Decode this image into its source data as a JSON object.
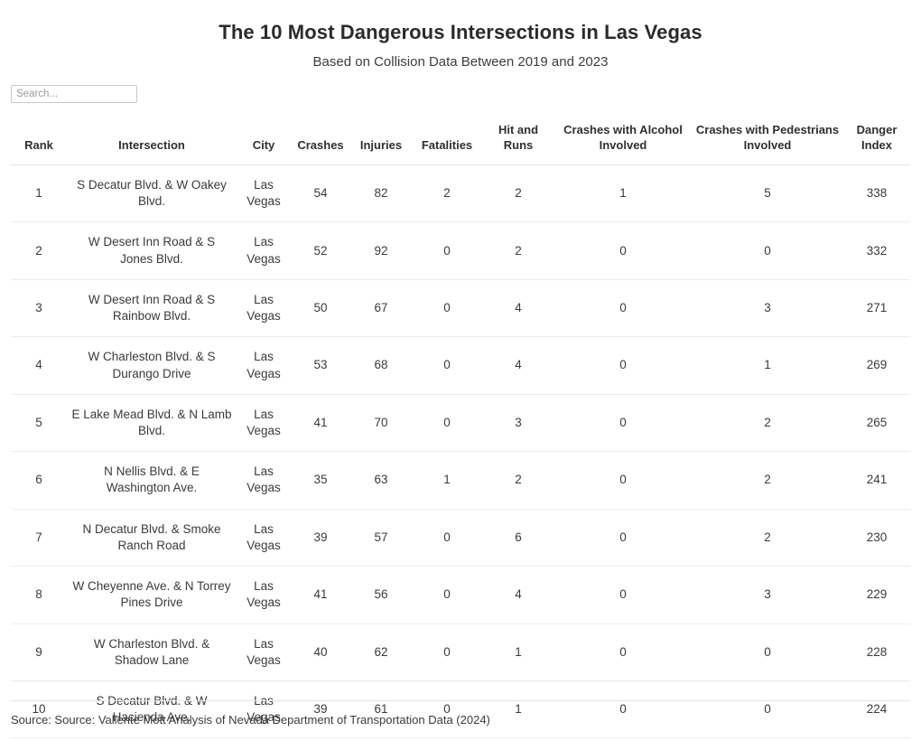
{
  "header": {
    "title": "The 10 Most Dangerous Intersections in Las Vegas",
    "subtitle": "Based on Collision Data Between 2019 and 2023"
  },
  "search": {
    "placeholder": "Search...",
    "value": ""
  },
  "table": {
    "columns": [
      "Rank",
      "Intersection",
      "City",
      "Crashes",
      "Injuries",
      "Fatalities",
      "Hit and Runs",
      "Crashes with Alcohol Involved",
      "Crashes with Pedestrians Involved",
      "Danger Index"
    ],
    "rows": [
      {
        "rank": "1",
        "intersection": "S Decatur Blvd. & W Oakey Blvd.",
        "city": "Las Vegas",
        "crashes": "54",
        "injuries": "82",
        "fatalities": "2",
        "hit_and_runs": "2",
        "alcohol": "1",
        "pedestrians": "5",
        "danger_index": "338"
      },
      {
        "rank": "2",
        "intersection": "W Desert Inn Road & S Jones Blvd.",
        "city": "Las Vegas",
        "crashes": "52",
        "injuries": "92",
        "fatalities": "0",
        "hit_and_runs": "2",
        "alcohol": "0",
        "pedestrians": "0",
        "danger_index": "332"
      },
      {
        "rank": "3",
        "intersection": "W Desert Inn Road & S Rainbow Blvd.",
        "city": "Las Vegas",
        "crashes": "50",
        "injuries": "67",
        "fatalities": "0",
        "hit_and_runs": "4",
        "alcohol": "0",
        "pedestrians": "3",
        "danger_index": "271"
      },
      {
        "rank": "4",
        "intersection": "W Charleston Blvd. & S Durango Drive",
        "city": "Las Vegas",
        "crashes": "53",
        "injuries": "68",
        "fatalities": "0",
        "hit_and_runs": "4",
        "alcohol": "0",
        "pedestrians": "1",
        "danger_index": "269"
      },
      {
        "rank": "5",
        "intersection": "E Lake Mead Blvd. & N Lamb Blvd.",
        "city": "Las Vegas",
        "crashes": "41",
        "injuries": "70",
        "fatalities": "0",
        "hit_and_runs": "3",
        "alcohol": "0",
        "pedestrians": "2",
        "danger_index": "265"
      },
      {
        "rank": "6",
        "intersection": "N Nellis Blvd. & E Washington Ave.",
        "city": "Las Vegas",
        "crashes": "35",
        "injuries": "63",
        "fatalities": "1",
        "hit_and_runs": "2",
        "alcohol": "0",
        "pedestrians": "2",
        "danger_index": "241"
      },
      {
        "rank": "7",
        "intersection": "N Decatur Blvd. & Smoke Ranch Road",
        "city": "Las Vegas",
        "crashes": "39",
        "injuries": "57",
        "fatalities": "0",
        "hit_and_runs": "6",
        "alcohol": "0",
        "pedestrians": "2",
        "danger_index": "230"
      },
      {
        "rank": "8",
        "intersection": "W Cheyenne Ave. & N Torrey Pines Drive",
        "city": "Las Vegas",
        "crashes": "41",
        "injuries": "56",
        "fatalities": "0",
        "hit_and_runs": "4",
        "alcohol": "0",
        "pedestrians": "3",
        "danger_index": "229"
      },
      {
        "rank": "9",
        "intersection": "W Charleston Blvd. & Shadow Lane",
        "city": "Las Vegas",
        "crashes": "40",
        "injuries": "62",
        "fatalities": "0",
        "hit_and_runs": "1",
        "alcohol": "0",
        "pedestrians": "0",
        "danger_index": "228"
      },
      {
        "rank": "10",
        "intersection": "S Decatur Blvd. & W Hacienda Ave.",
        "city": "Las Vegas",
        "crashes": "39",
        "injuries": "61",
        "fatalities": "0",
        "hit_and_runs": "1",
        "alcohol": "0",
        "pedestrians": "0",
        "danger_index": "224"
      }
    ]
  },
  "footer": {
    "source": "Source: Source: Valiente Mott Analysis of Nevada Department of Transportation Data (2024)"
  },
  "chart_data": {
    "type": "table",
    "title": "The 10 Most Dangerous Intersections in Las Vegas",
    "subtitle": "Based on Collision Data Between 2019 and 2023",
    "columns": [
      "Rank",
      "Intersection",
      "City",
      "Crashes",
      "Injuries",
      "Fatalities",
      "Hit and Runs",
      "Crashes with Alcohol Involved",
      "Crashes with Pedestrians Involved",
      "Danger Index"
    ],
    "rows": [
      [
        "1",
        "S Decatur Blvd. & W Oakey Blvd.",
        "Las Vegas",
        54,
        82,
        2,
        2,
        1,
        5,
        338
      ],
      [
        "2",
        "W Desert Inn Road & S Jones Blvd.",
        "Las Vegas",
        52,
        92,
        0,
        2,
        0,
        0,
        332
      ],
      [
        "3",
        "W Desert Inn Road & S Rainbow Blvd.",
        "Las Vegas",
        50,
        67,
        0,
        4,
        0,
        3,
        271
      ],
      [
        "4",
        "W Charleston Blvd. & S Durango Drive",
        "Las Vegas",
        53,
        68,
        0,
        4,
        0,
        1,
        269
      ],
      [
        "5",
        "E Lake Mead Blvd. & N Lamb Blvd.",
        "Las Vegas",
        41,
        70,
        0,
        3,
        0,
        2,
        265
      ],
      [
        "6",
        "N Nellis Blvd. & E Washington Ave.",
        "Las Vegas",
        35,
        63,
        1,
        2,
        0,
        2,
        241
      ],
      [
        "7",
        "N Decatur Blvd. & Smoke Ranch Road",
        "Las Vegas",
        39,
        57,
        0,
        6,
        0,
        2,
        230
      ],
      [
        "8",
        "W Cheyenne Ave. & N Torrey Pines Drive",
        "Las Vegas",
        41,
        56,
        0,
        4,
        0,
        3,
        229
      ],
      [
        "9",
        "W Charleston Blvd. & Shadow Lane",
        "Las Vegas",
        40,
        62,
        0,
        1,
        0,
        0,
        228
      ],
      [
        "10",
        "S Decatur Blvd. & W Hacienda Ave.",
        "Las Vegas",
        39,
        61,
        0,
        1,
        0,
        0,
        224
      ]
    ],
    "source": "Source: Source: Valiente Mott Analysis of Nevada Department of Transportation Data (2024)"
  }
}
